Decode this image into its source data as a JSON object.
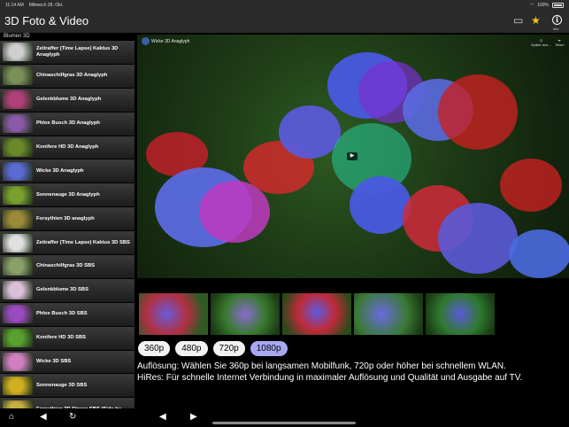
{
  "status_bar": {
    "time": "11:14 AM",
    "date": "Mittwoch 28. Okt.",
    "battery": "100%"
  },
  "header": {
    "title": "3D Foto & Video",
    "info_label": "info"
  },
  "sidebar": {
    "section_title": "Blumen 3D",
    "items": [
      {
        "label": "Zeitraffer (Time Lapse) Kaktus 3D Anaglyph",
        "color": "#cfcfcf"
      },
      {
        "label": "Chinaschilfgras 3D Anaglyph",
        "color": "#7a8f5a"
      },
      {
        "label": "Gelenkblume 3D Anaglyph",
        "color": "#b0407a"
      },
      {
        "label": "Phlox Busch 3D Anaglyph",
        "color": "#8a5aa8"
      },
      {
        "label": "Konifere HD 3D Anaglyph",
        "color": "#6a8a2a"
      },
      {
        "label": "Wicke 3D Anaglyph",
        "color": "#5a6ad0"
      },
      {
        "label": "Sonnenauge 3D Anaglyph",
        "color": "#7aa030"
      },
      {
        "label": "Forsythien 3D anaglyph",
        "color": "#9a8a3a"
      },
      {
        "label": "Zeitraffer (Time Lapse) Kaktus 3D SBS",
        "color": "#e0e0e0"
      },
      {
        "label": "Chinaschilfgras 3D SBS",
        "color": "#8aa06a"
      },
      {
        "label": "Gelenkblume 3D SBS",
        "color": "#d8c0d8"
      },
      {
        "label": "Phlox Busch 3D SBS",
        "color": "#9a4ac0"
      },
      {
        "label": "Konifere HD 3D SBS",
        "color": "#5aa030"
      },
      {
        "label": "Wicke 3D SBS",
        "color": "#d080c0"
      },
      {
        "label": "Sonnenauge 3D SBS",
        "color": "#d0b020"
      },
      {
        "label": "Forsythien 3D Stereo SBS (Side by",
        "color": "#c8b040"
      }
    ]
  },
  "video": {
    "title": "Wicke 3D Anaglyph",
    "watch_later": "Später ans...",
    "share": "Teilen"
  },
  "resolutions": {
    "r360": "360p",
    "r480": "480p",
    "r720": "720p",
    "r1080": "1080p",
    "selected": "1080p",
    "active_color": "#a8a8f2"
  },
  "info": {
    "line1": "Auflösung: Wählen Sie 360p bei langsamen Mobilfunk, 720p oder höher bei schnellem WLAN.",
    "line2": "HiRes: Für schnelle Internet Verbindung in maximaler Auflösung und Qualität und Ausgabe auf TV."
  },
  "colors": {
    "star": "#f5c518",
    "bar_bg": "#2b2b2b"
  },
  "icons": {
    "home": "home-icon",
    "back": "back-arrow-icon",
    "reload": "reload-icon",
    "prev": "previous-icon",
    "next": "next-icon",
    "star": "star-icon",
    "tray": "inbox-tray-icon",
    "info": "info-icon"
  }
}
